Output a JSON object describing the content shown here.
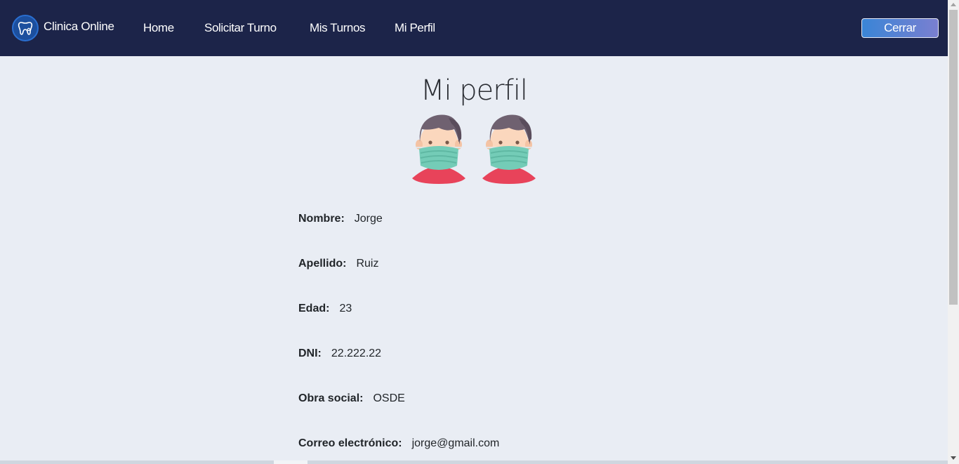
{
  "navbar": {
    "brand": "Clinica Online",
    "links": [
      "Home",
      "Solicitar Turno",
      "Mis Turnos",
      "Mi Perfil"
    ],
    "logout_label": "Cerrar"
  },
  "page": {
    "title": "Mi perfil"
  },
  "profile": {
    "fields": [
      {
        "label": "Nombre:",
        "value": "Jorge"
      },
      {
        "label": "Apellido:",
        "value": "Ruiz"
      },
      {
        "label": "Edad:",
        "value": "23"
      },
      {
        "label": "DNI:",
        "value": "22.222.22"
      },
      {
        "label": "Obra social:",
        "value": "OSDE"
      },
      {
        "label": "Correo electrónico:",
        "value": "jorge@gmail.com"
      }
    ]
  },
  "icons": {
    "brand": "tooth-stethoscope-logo-icon",
    "avatar": "masked-man-avatar-icon"
  },
  "colors": {
    "navbar_bg": "#1c2449",
    "page_bg": "#e9edf4",
    "button_gradient_start": "#3a85d6",
    "button_gradient_end": "#7a7fd0"
  }
}
